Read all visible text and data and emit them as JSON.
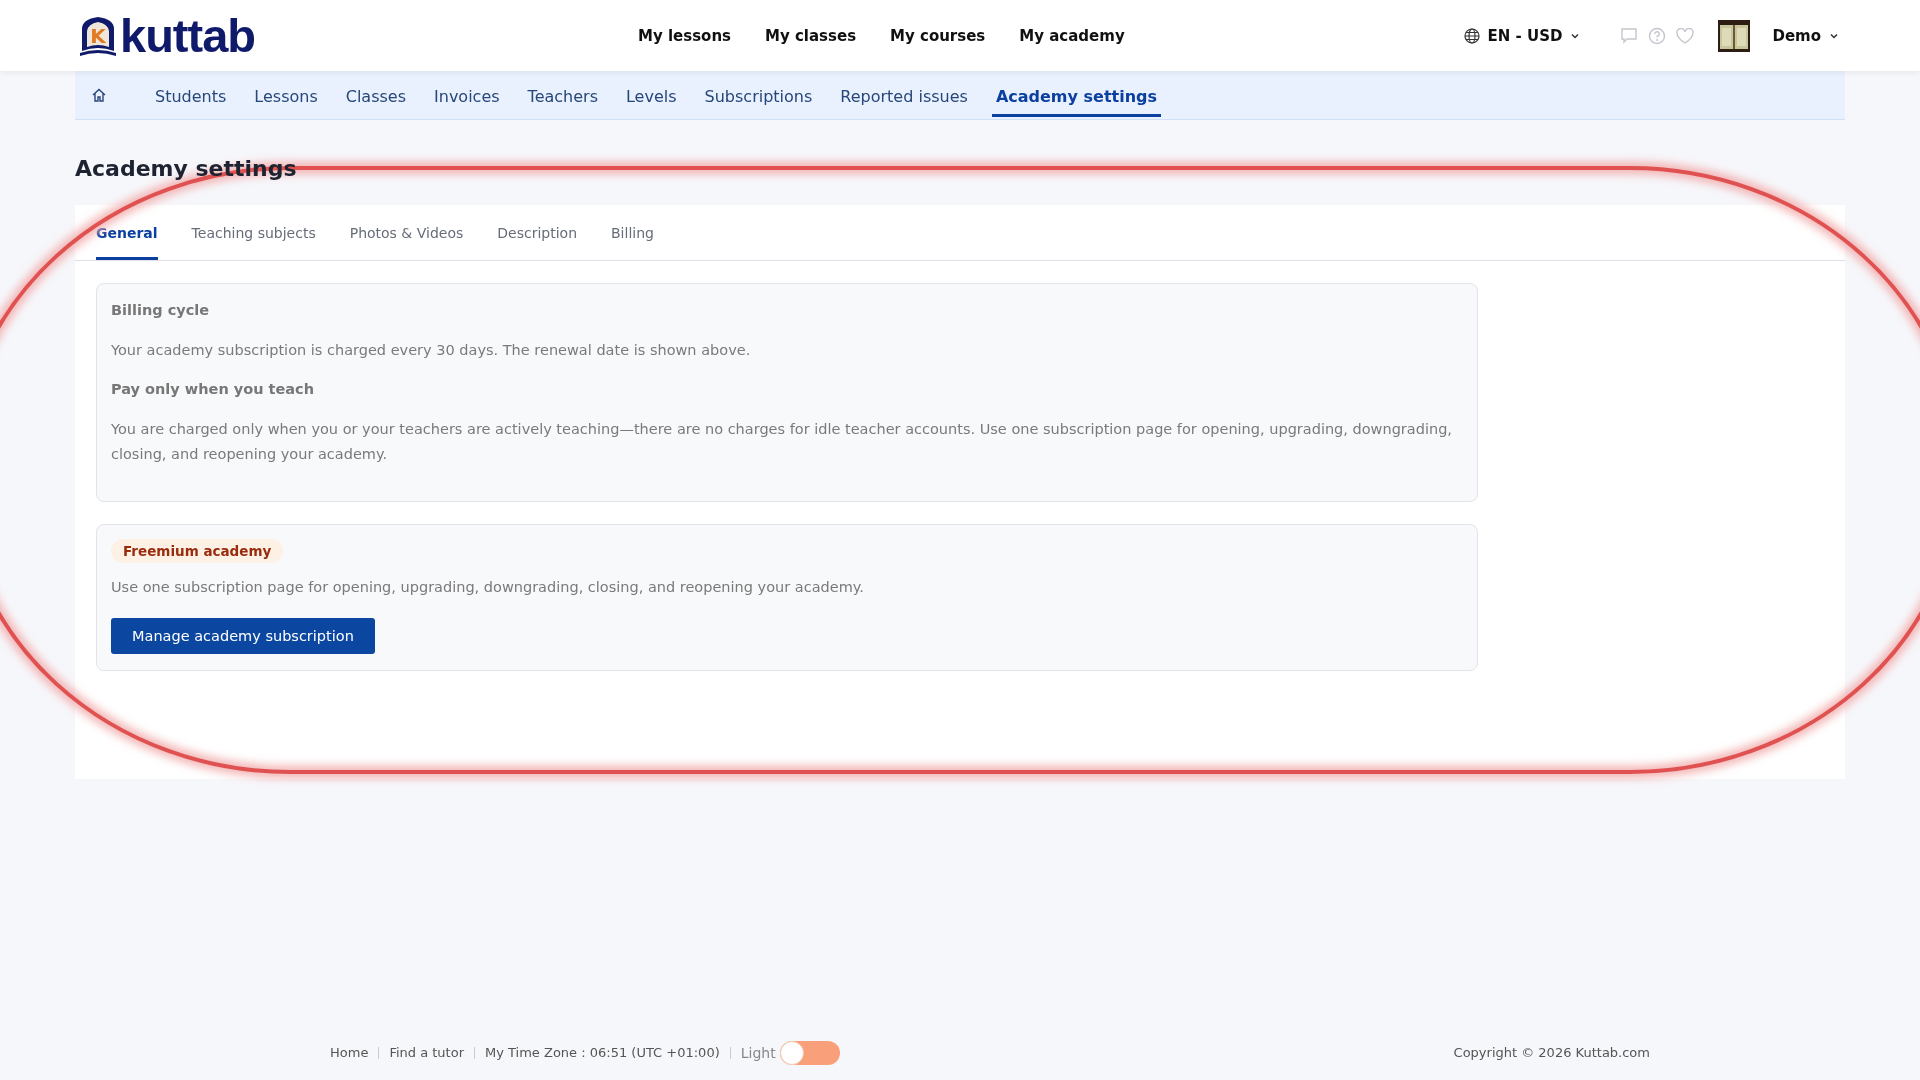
{
  "header": {
    "logo_mark": "K",
    "logo_text": "kuttab",
    "nav": [
      {
        "label": "My lessons"
      },
      {
        "label": "My classes"
      },
      {
        "label": "My courses"
      },
      {
        "label": "My academy"
      }
    ],
    "language": "EN - USD",
    "user": "Demo"
  },
  "subnav": [
    {
      "label": "Students",
      "selected": false
    },
    {
      "label": "Lessons",
      "selected": false
    },
    {
      "label": "Classes",
      "selected": false
    },
    {
      "label": "Invoices",
      "selected": false
    },
    {
      "label": "Teachers",
      "selected": false
    },
    {
      "label": "Levels",
      "selected": false
    },
    {
      "label": "Subscriptions",
      "selected": false
    },
    {
      "label": "Reported issues",
      "selected": false
    },
    {
      "label": "Academy settings",
      "selected": true
    }
  ],
  "page_title": "Academy settings",
  "tabs": [
    {
      "label": "General",
      "selected": true
    },
    {
      "label": "Teaching subjects",
      "selected": false
    },
    {
      "label": "Photos & Videos",
      "selected": false
    },
    {
      "label": "Description",
      "selected": false
    },
    {
      "label": "Billing",
      "selected": false
    }
  ],
  "billing_box": {
    "blocks": [
      {
        "kind": "heading",
        "text": "Billing cycle"
      },
      {
        "kind": "paragraph",
        "text": "Your academy subscription is charged every 30 days. The renewal date is shown above."
      },
      {
        "kind": "heading",
        "text": "Pay only when you teach"
      },
      {
        "kind": "paragraph",
        "text": "You are charged only when you or your teachers are actively teaching—there are no charges for idle teacher accounts. Use one subscription page for opening, upgrading, downgrading, closing, and reopening your academy."
      }
    ]
  },
  "plan_box": {
    "badge": "Freemium academy",
    "text": "Use one subscription page for opening, upgrading, downgrading, closing, and reopening your academy.",
    "button": "Manage academy subscription"
  },
  "footer": {
    "links": [
      {
        "label": "Home"
      },
      {
        "label": "Find a tutor"
      },
      {
        "label": "My Time Zone : 06:51 (UTC +01:00)"
      }
    ],
    "theme_label": "Light",
    "dark_mode": false,
    "copyright": "Copyright © 2026 Kuttab.com"
  }
}
